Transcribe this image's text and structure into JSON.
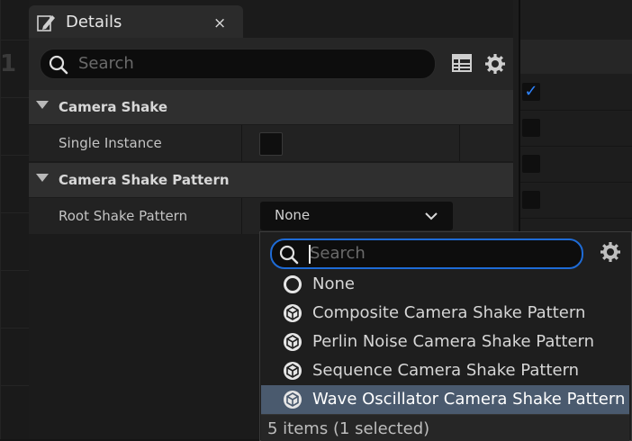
{
  "tab": {
    "title": "Details",
    "close": "×"
  },
  "search": {
    "placeholder": "Search"
  },
  "background": {
    "graph_number": "1"
  },
  "categories": [
    {
      "label": "Camera Shake"
    },
    {
      "label": "Camera Shake Pattern"
    }
  ],
  "properties": {
    "single_instance": {
      "label": "Single Instance",
      "checked": false
    },
    "root_shake_pattern": {
      "label": "Root Shake Pattern",
      "value": "None"
    }
  },
  "dropdown": {
    "search_placeholder": "Search",
    "items": [
      {
        "label": "None",
        "icon": "none-circle-icon",
        "selected": false
      },
      {
        "label": "Composite Camera Shake Pattern",
        "icon": "class-cube-icon",
        "selected": false
      },
      {
        "label": "Perlin Noise Camera Shake Pattern",
        "icon": "class-cube-icon",
        "selected": false
      },
      {
        "label": "Sequence Camera Shake Pattern",
        "icon": "class-cube-icon",
        "selected": false
      },
      {
        "label": "Wave Oscillator Camera Shake Pattern",
        "icon": "class-cube-icon",
        "selected": true
      }
    ],
    "footer": "5 items (1 selected)"
  },
  "colors": {
    "accent": "#1e6bd6",
    "selection": "#4a5a6e",
    "checkbox_check": "#2e83ff"
  }
}
